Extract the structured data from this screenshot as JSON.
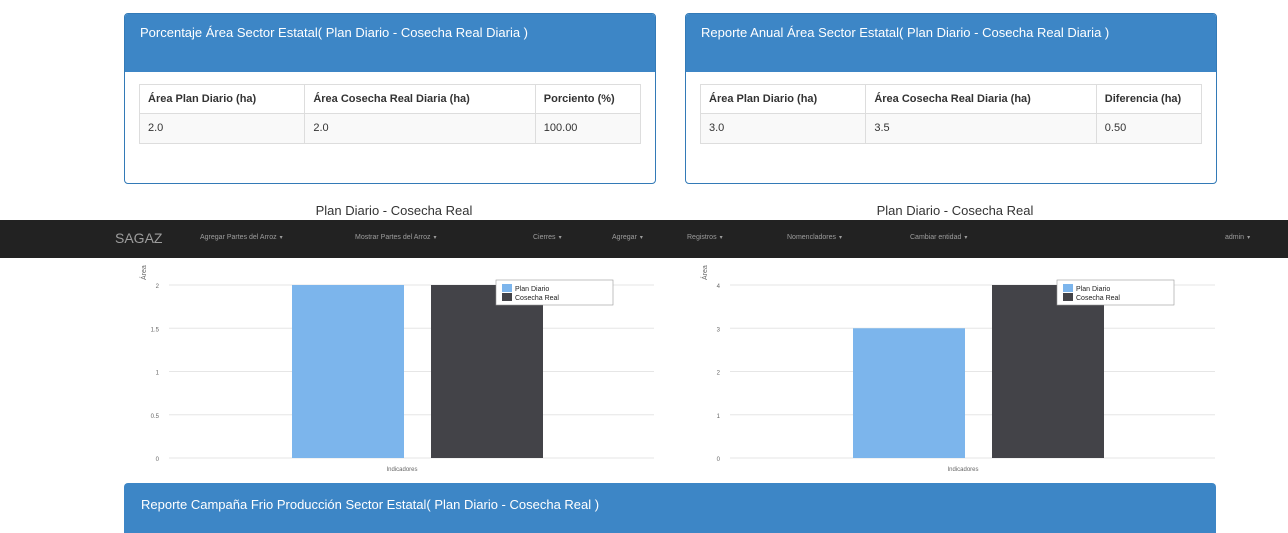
{
  "panel_left": {
    "title": "Porcentaje Área Sector Estatal( Plan Diario - Cosecha Real Diaria )",
    "headers": [
      "Área Plan Diario (ha)",
      "Área Cosecha Real Diaria (ha)",
      "Porciento (%)"
    ],
    "row": [
      "2.0",
      "2.0",
      "100.00"
    ]
  },
  "panel_right": {
    "title": "Reporte Anual Área Sector Estatal( Plan Diario - Cosecha Real Diaria )",
    "headers": [
      "Área Plan Diario (ha)",
      "Área Cosecha Real Diaria (ha)",
      "Diferencia (ha)"
    ],
    "row": [
      "3.0",
      "3.5",
      "0.50"
    ]
  },
  "navbar": {
    "brand": "SAGAZ",
    "items": [
      {
        "label": "Agregar Partes del Arroz",
        "caret": "▾"
      },
      {
        "label": "Mostrar Partes del Arroz",
        "caret": "▾"
      },
      {
        "label": "Cierres",
        "caret": "▾"
      },
      {
        "label": "Agregar",
        "caret": "▾"
      },
      {
        "label": "Registros",
        "caret": "▾"
      },
      {
        "label": "Nomencladores",
        "caret": "▾"
      },
      {
        "label": "Cambiar entidad",
        "caret": "▾"
      }
    ],
    "user": "admin",
    "user_caret": "▾"
  },
  "chart_data": [
    {
      "type": "bar",
      "title": "Plan Diario - Cosecha Real",
      "xlabel": "Indicadores",
      "ylabel": "Área",
      "ylim": [
        0,
        2
      ],
      "yticks": [
        "0",
        "0.5",
        "1",
        "1.5",
        "2"
      ],
      "legend": "top-right",
      "series": [
        {
          "name": "Plan Diario",
          "values": [
            2.0
          ],
          "color": "#7cb5ec"
        },
        {
          "name": "Cosecha Real",
          "values": [
            2.0
          ],
          "color": "#434348"
        }
      ]
    },
    {
      "type": "bar",
      "title": "Plan Diario - Cosecha Real",
      "xlabel": "Indicadores",
      "ylabel": "Área",
      "ylim": [
        0,
        4
      ],
      "yticks": [
        "0",
        "1",
        "2",
        "3",
        "4"
      ],
      "legend": "top-right",
      "series": [
        {
          "name": "Plan Diario",
          "values": [
            3.0
          ],
          "color": "#7cb5ec"
        },
        {
          "name": "Cosecha Real",
          "values": [
            4.0
          ],
          "color": "#434348"
        }
      ]
    }
  ],
  "bottom_panel": {
    "title": "Reporte Campaña Frio Producción Sector Estatal( Plan Diario - Cosecha Real )"
  }
}
